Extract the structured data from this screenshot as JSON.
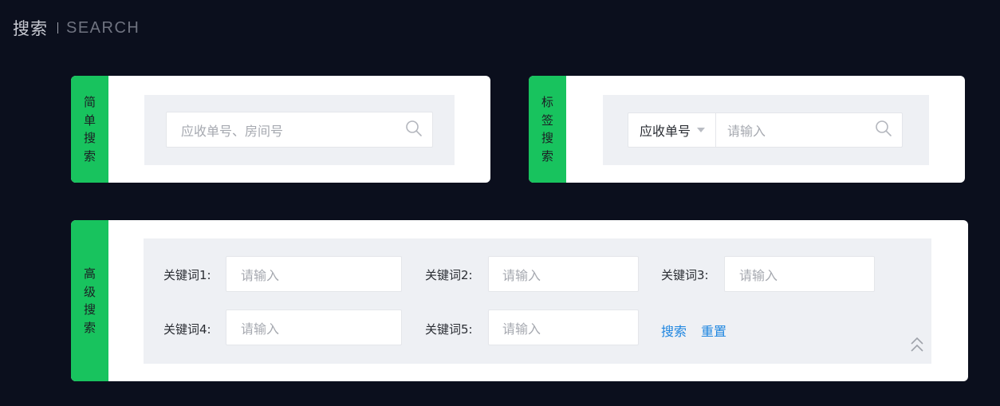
{
  "header": {
    "title_zh": "搜索",
    "title_en": "SEARCH"
  },
  "simple_search": {
    "tag_chars": [
      "简",
      "单",
      "搜",
      "索"
    ],
    "placeholder": "应收单号、房间号"
  },
  "tag_search": {
    "tag_chars": [
      "标",
      "签",
      "搜",
      "索"
    ],
    "select_value": "应收单号",
    "placeholder": "请输入"
  },
  "advanced_search": {
    "tag_chars": [
      "高",
      "级",
      "搜",
      "索"
    ],
    "fields": [
      {
        "label": "关键词1:",
        "placeholder": "请输入"
      },
      {
        "label": "关键词2:",
        "placeholder": "请输入"
      },
      {
        "label": "关键词3:",
        "placeholder": "请输入"
      },
      {
        "label": "关键词4:",
        "placeholder": "请输入"
      },
      {
        "label": "关键词5:",
        "placeholder": "请输入"
      }
    ],
    "search_label": "搜索",
    "reset_label": "重置"
  },
  "icons": [
    "search-icon",
    "caret-down-icon",
    "collapse-up-icon"
  ],
  "colors": {
    "accent_green": "#18c35e",
    "link_blue": "#1f86e0",
    "background": "#0b0f1d"
  }
}
